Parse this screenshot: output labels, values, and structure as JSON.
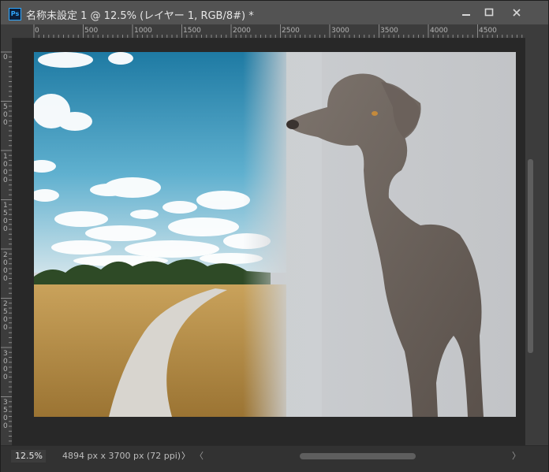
{
  "app": {
    "logo_text": "Ps",
    "document_title": "名称未設定 1 @ 12.5% (レイヤー 1, RGB/8#) *"
  },
  "window_controls": {
    "minimize_icon": "minimize-icon",
    "maximize_icon": "maximize-icon",
    "close_icon": "close-icon"
  },
  "ruler": {
    "horizontal": [
      "0",
      "500",
      "1000",
      "1500",
      "2000",
      "2500",
      "3000",
      "3500",
      "4000",
      "4500"
    ],
    "vertical": [
      "0",
      "500",
      "1000",
      "1500",
      "2000",
      "2500",
      "3000",
      "3500"
    ]
  },
  "status": {
    "zoom": "12.5%",
    "doc_info": "4894 px x 3700 px (72 ppi)",
    "info_arrow": "〉",
    "scroll_left": "〈",
    "scroll_right": "〉"
  },
  "canvas": {
    "sky_color": "#2f8db3",
    "wall_color": "#cdd0d3",
    "grass_color": "#b08a45",
    "dog_color": "#6f6660"
  }
}
